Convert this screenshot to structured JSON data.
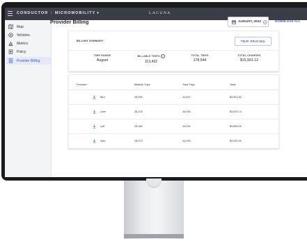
{
  "topbar": {
    "brand": "CONDUCTOR",
    "separator": "|",
    "product_area": "MICROMOBILITY",
    "app_name": "LACUNA"
  },
  "sidebar": {
    "items": [
      {
        "label": "Map",
        "icon": "map-icon",
        "active": false
      },
      {
        "label": "Vehicles",
        "icon": "vehicles-icon",
        "active": false
      },
      {
        "label": "Metrics",
        "icon": "metrics-icon",
        "active": false
      },
      {
        "label": "Policy",
        "icon": "policy-icon",
        "active": false
      },
      {
        "label": "Provider Billing",
        "icon": "billing-icon",
        "active": true
      }
    ]
  },
  "header": {
    "title": "Provider Billing",
    "date_value": "AUGUST, 2022",
    "download_label": "DOWNLOAD ALL"
  },
  "summary": {
    "title": "BILLING SUMMARY",
    "trip_pricing_label": "TRIP PRICING",
    "metrics": [
      {
        "label": "TIME RANGE",
        "value": "August"
      },
      {
        "label": "BILLABLE TRIPS",
        "value": "113,432"
      },
      {
        "label": "TOTAL TRIPS",
        "value": "178,544"
      },
      {
        "label": "TOTAL CHARGES",
        "value": "$15,561.12"
      }
    ]
  },
  "table": {
    "headers": [
      "Provider",
      "Billable Trips",
      "Total Trips",
      "Total"
    ],
    "rows": [
      {
        "provider": "Bird",
        "billable": "28,395",
        "total_trips": "44,537",
        "total": "$3,902.82"
      },
      {
        "provider": "Lime",
        "billable": "28,378",
        "total_trips": "44,036",
        "total": "$3,878.74"
      },
      {
        "provider": "Lyft",
        "billable": "28,186",
        "total_trips": "44,034",
        "total": "$3,859.16"
      },
      {
        "provider": "Spin",
        "billable": "28,473",
        "total_trips": "44,035",
        "total": "$3,920.40"
      }
    ]
  },
  "colors": {
    "accent": "#3e58c9",
    "topbar": "#3a3d46",
    "sidebar_active_bg": "#e4e8fb"
  }
}
